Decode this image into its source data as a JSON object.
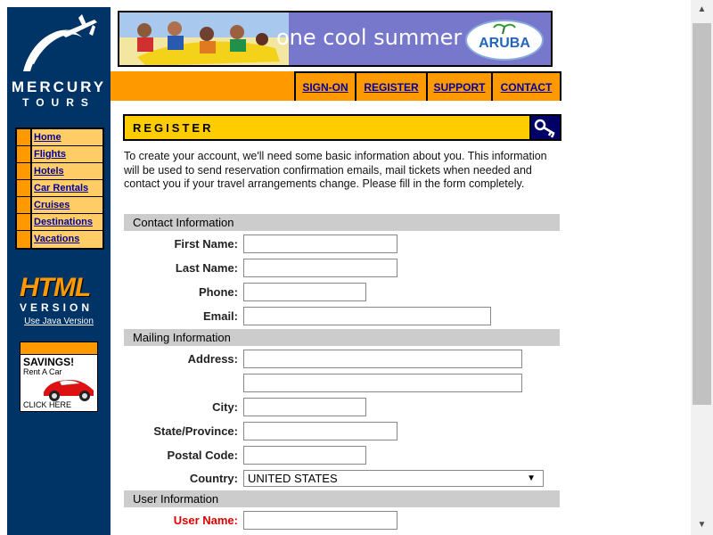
{
  "logo": {
    "line1": "MERCURY",
    "line2": "TOURS"
  },
  "sidebar": {
    "nav": [
      {
        "label": "Home"
      },
      {
        "label": "Flights"
      },
      {
        "label": "Hotels"
      },
      {
        "label": "Car Rentals"
      },
      {
        "label": "Cruises"
      },
      {
        "label": "Destinations"
      },
      {
        "label": "Vacations"
      }
    ],
    "html_word": "HTML",
    "version_word": "VERSION",
    "java_link": "Use Java Version",
    "ad": {
      "title": "SAVINGS!",
      "sub": "Rent A Car",
      "click": "CLICK HERE"
    }
  },
  "banner": {
    "tagline": "one cool summer",
    "brand": "ARUBA"
  },
  "topnav": [
    "SIGN-ON",
    "REGISTER",
    "SUPPORT",
    "CONTACT"
  ],
  "register": {
    "title": "REGISTER",
    "intro": "To create your account, we'll need some basic information about you. This information will be used to send reservation confirmation emails, mail tickets when needed and contact you if your travel arrangements change. Please fill in the form completely."
  },
  "sections": {
    "contact": "Contact Information",
    "mailing": "Mailing Information",
    "user": "User Information"
  },
  "fields": {
    "first_name": "First Name:",
    "last_name": "Last Name:",
    "phone": "Phone:",
    "email": "Email:",
    "address": "Address:",
    "city": "City:",
    "state": "State/Province:",
    "postal": "Postal Code:",
    "country": "Country:",
    "user_name": "User Name:"
  },
  "country_value": "UNITED STATES",
  "colors": {
    "sidebar": "#003366",
    "accent": "#ff9900",
    "nav_cell": "#ffcc66",
    "register_bar": "#ffcc00",
    "required": "#dd0000"
  }
}
